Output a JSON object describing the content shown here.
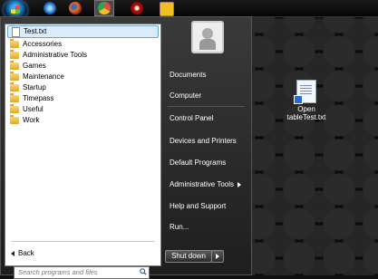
{
  "taskbar": {
    "pinned": [
      {
        "name": "internet-explorer-icon",
        "color": "#2a7fd6"
      },
      {
        "name": "firefox-icon",
        "color": "#e8702a"
      },
      {
        "name": "chrome-icon",
        "color": "#e14b3b"
      },
      {
        "name": "opera-icon",
        "color": "#cc1111"
      },
      {
        "name": "sticky-app-icon",
        "color": "#f0c020"
      }
    ]
  },
  "start_menu": {
    "recent_item": "Test.txt",
    "programs": [
      "Accessories",
      "Administrative Tools",
      "Games",
      "Maintenance",
      "Startup",
      "Timepass",
      "Useful",
      "Work"
    ],
    "back_label": "Back",
    "search_placeholder": "Search programs and files",
    "right_items": {
      "documents": "Documents",
      "computer": "Computer",
      "control_panel": "Control Panel",
      "devices_printers": "Devices and Printers",
      "default_programs": "Default Programs",
      "admin_tools": "Administrative Tools",
      "help_support": "Help and Support",
      "run": "Run..."
    },
    "shutdown_label": "Shut down"
  },
  "desktop": {
    "file_label_line1": "Open",
    "file_label_line2": "tableTest.txt"
  }
}
